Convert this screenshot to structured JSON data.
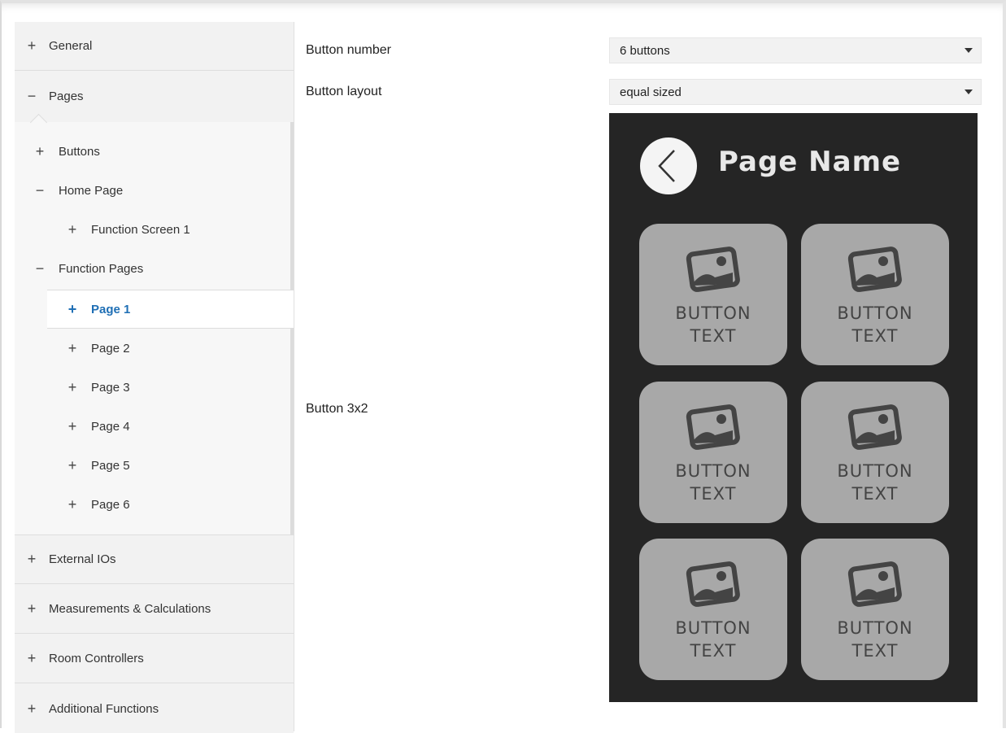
{
  "sidebar": {
    "items": [
      {
        "sign": "+",
        "label": "General"
      },
      {
        "sign": "−",
        "label": "Pages"
      },
      {
        "sign": "+",
        "label": "External IOs"
      },
      {
        "sign": "+",
        "label": "Measurements & Calculations"
      },
      {
        "sign": "+",
        "label": "Room Controllers"
      },
      {
        "sign": "+",
        "label": "Additional Functions"
      }
    ],
    "pages_children": [
      {
        "sign": "+",
        "label": "Buttons"
      },
      {
        "sign": "−",
        "label": "Home Page"
      },
      {
        "sign": "+",
        "label": "Function Screen 1"
      },
      {
        "sign": "−",
        "label": "Function Pages"
      },
      {
        "sign": "+",
        "label": "Page 1"
      },
      {
        "sign": "+",
        "label": "Page 2"
      },
      {
        "sign": "+",
        "label": "Page 3"
      },
      {
        "sign": "+",
        "label": "Page 4"
      },
      {
        "sign": "+",
        "label": "Page 5"
      },
      {
        "sign": "+",
        "label": "Page 6"
      }
    ]
  },
  "main": {
    "button_number": {
      "label": "Button number",
      "value": "6 buttons"
    },
    "button_layout": {
      "label": "Button layout",
      "value": "equal sized"
    },
    "preview_label": "Button 3x2",
    "preview": {
      "page_name": "Page Name",
      "tile_line1": "BUTTON",
      "tile_line2": "TEXT"
    }
  },
  "colors": {
    "selected_text": "#1f6fb5",
    "preview_background": "#252525",
    "tile_background": "#a8a8a8"
  },
  "icons": {
    "expand": "plus-icon",
    "collapse": "minus-icon",
    "back": "chevron-left-icon",
    "tile": "image-placeholder-icon"
  }
}
